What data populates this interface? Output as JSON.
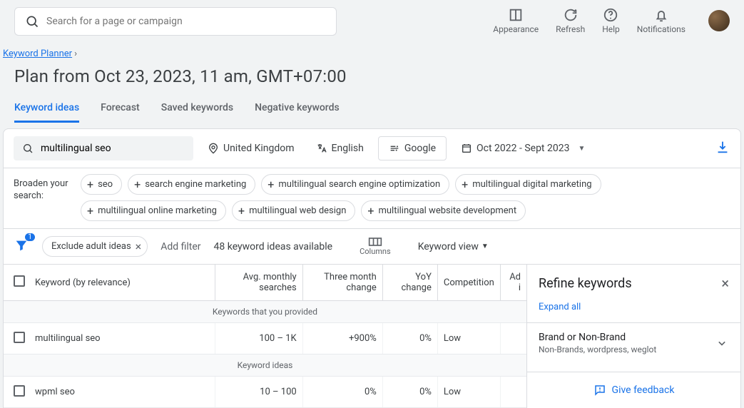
{
  "header": {
    "search_placeholder": "Search for a page or campaign",
    "actions": {
      "appearance": "Appearance",
      "refresh": "Refresh",
      "help": "Help",
      "notifications": "Notifications"
    }
  },
  "breadcrumb": {
    "root": "Keyword Planner"
  },
  "page_title": "Plan from Oct 23, 2023, 11 am, GMT+07:00",
  "tabs": [
    {
      "label": "Keyword ideas",
      "active": true
    },
    {
      "label": "Forecast"
    },
    {
      "label": "Saved keywords"
    },
    {
      "label": "Negative keywords"
    }
  ],
  "filters": {
    "keyword_value": "multilingual seo",
    "location": "United Kingdom",
    "language": "English",
    "network": "Google",
    "date_range": "Oct 2022 - Sept 2023"
  },
  "broaden": {
    "label": "Broaden your search:",
    "chips": [
      "seo",
      "search engine marketing",
      "multilingual search engine optimization",
      "multilingual digital marketing",
      "multilingual online marketing",
      "multilingual web design",
      "multilingual website development"
    ]
  },
  "toolbar": {
    "filter_badge": "1",
    "exclude_chip": "Exclude adult ideas",
    "add_filter": "Add filter",
    "ideas_count": "48 keyword ideas available",
    "columns_label": "Columns",
    "view_label": "Keyword view"
  },
  "table": {
    "columns": {
      "keyword": "Keyword (by relevance)",
      "avg": "Avg. monthly searches",
      "three_month": "Three month change",
      "yoy": "YoY change",
      "competition": "Competition",
      "ad": "Ad i"
    },
    "section_provided": "Keywords that you provided",
    "section_ideas": "Keyword ideas",
    "rows": [
      {
        "keyword": "multilingual seo",
        "avg": "100 – 1K",
        "three_month": "+900%",
        "yoy": "0%",
        "competition": "Low"
      },
      {
        "keyword": "wpml seo",
        "avg": "10 – 100",
        "three_month": "0%",
        "yoy": "0%",
        "competition": "Low"
      }
    ]
  },
  "refine": {
    "title": "Refine keywords",
    "expand_all": "Expand all",
    "section_title": "Brand or Non-Brand",
    "section_sub": "Non-Brands, wordpress, weglot",
    "feedback": "Give feedback"
  }
}
